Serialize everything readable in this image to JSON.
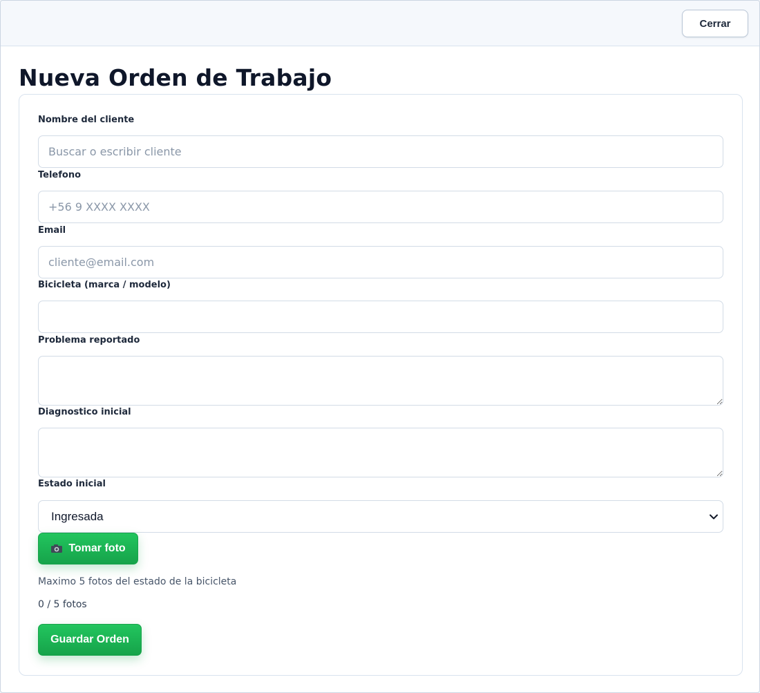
{
  "header": {
    "close_label": "Cerrar"
  },
  "page": {
    "title": "Nueva Orden de Trabajo"
  },
  "form": {
    "client": {
      "label": "Nombre del cliente",
      "placeholder": "Buscar o escribir cliente",
      "value": ""
    },
    "phone": {
      "label": "Telefono",
      "placeholder": "+56 9 XXXX XXXX",
      "value": ""
    },
    "email": {
      "label": "Email",
      "placeholder": "cliente@email.com",
      "value": ""
    },
    "bike": {
      "label": "Bicicleta (marca / modelo)",
      "placeholder": "",
      "value": ""
    },
    "problem": {
      "label": "Problema reportado",
      "value": ""
    },
    "diagnosis": {
      "label": "Diagnostico inicial",
      "value": ""
    },
    "status": {
      "label": "Estado inicial",
      "selected": "Ingresada"
    },
    "photo_button": {
      "label": "Tomar foto",
      "icon": "camera-icon"
    },
    "photo_helper": "Maximo 5 fotos del estado de la bicicleta",
    "photo_count": "0 / 5 fotos",
    "save_label": "Guardar Orden"
  },
  "colors": {
    "accent_green": "#16a34a",
    "border": "#d2dbe6",
    "title": "#0f172a"
  }
}
